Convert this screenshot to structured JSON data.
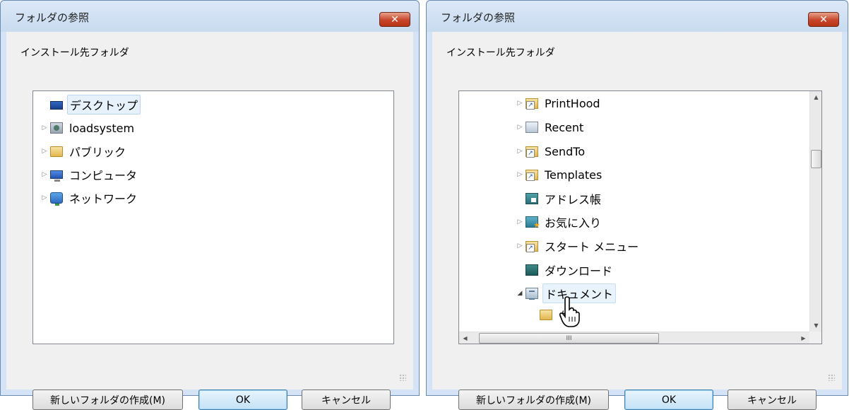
{
  "left_dialog": {
    "title": "フォルダの参照",
    "close_label": "✕",
    "description": "インストール先フォルダ",
    "tree_items": [
      {
        "label": "デスクトップ",
        "icon": "desktop-icon",
        "expander": "",
        "selected": true
      },
      {
        "label": "loadsystem",
        "icon": "user-folder-icon",
        "expander": "▷"
      },
      {
        "label": "パブリック",
        "icon": "folder-icon",
        "expander": "▷"
      },
      {
        "label": "コンピュータ",
        "icon": "computer-icon",
        "expander": "▷"
      },
      {
        "label": "ネットワーク",
        "icon": "network-icon",
        "expander": "▷"
      }
    ],
    "new_folder_label": "新しいフォルダの作成(M)",
    "ok_label": "OK",
    "cancel_label": "キャンセル"
  },
  "right_dialog": {
    "title": "フォルダの参照",
    "close_label": "✕",
    "description": "インストール先フォルダ",
    "tree_items": [
      {
        "label": "PrintHood",
        "icon": "shortcut-folder-icon",
        "expander": "▷"
      },
      {
        "label": "Recent",
        "icon": "recent-folder-icon",
        "expander": "▷"
      },
      {
        "label": "SendTo",
        "icon": "shortcut-folder-icon",
        "expander": "▷"
      },
      {
        "label": "Templates",
        "icon": "shortcut-folder-icon",
        "expander": "▷"
      },
      {
        "label": "アドレス帳",
        "icon": "address-book-icon",
        "expander": ""
      },
      {
        "label": "お気に入り",
        "icon": "favorites-icon",
        "expander": "▷"
      },
      {
        "label": "スタート メニュー",
        "icon": "shortcut-folder-icon",
        "expander": "▷"
      },
      {
        "label": "ダウンロード",
        "icon": "downloads-icon",
        "expander": ""
      },
      {
        "label": "ドキュメント",
        "icon": "documents-icon",
        "expander": "◢",
        "hover": true
      },
      {
        "label": "#",
        "icon": "folder-icon",
        "expander": ""
      }
    ],
    "scroll_up": "▲",
    "scroll_down": "▼",
    "scroll_left": "◀",
    "scroll_right": "▶",
    "hthumb_grip": "III",
    "new_folder_label": "新しいフォルダの作成(M)",
    "ok_label": "OK",
    "cancel_label": "キャンセル"
  }
}
